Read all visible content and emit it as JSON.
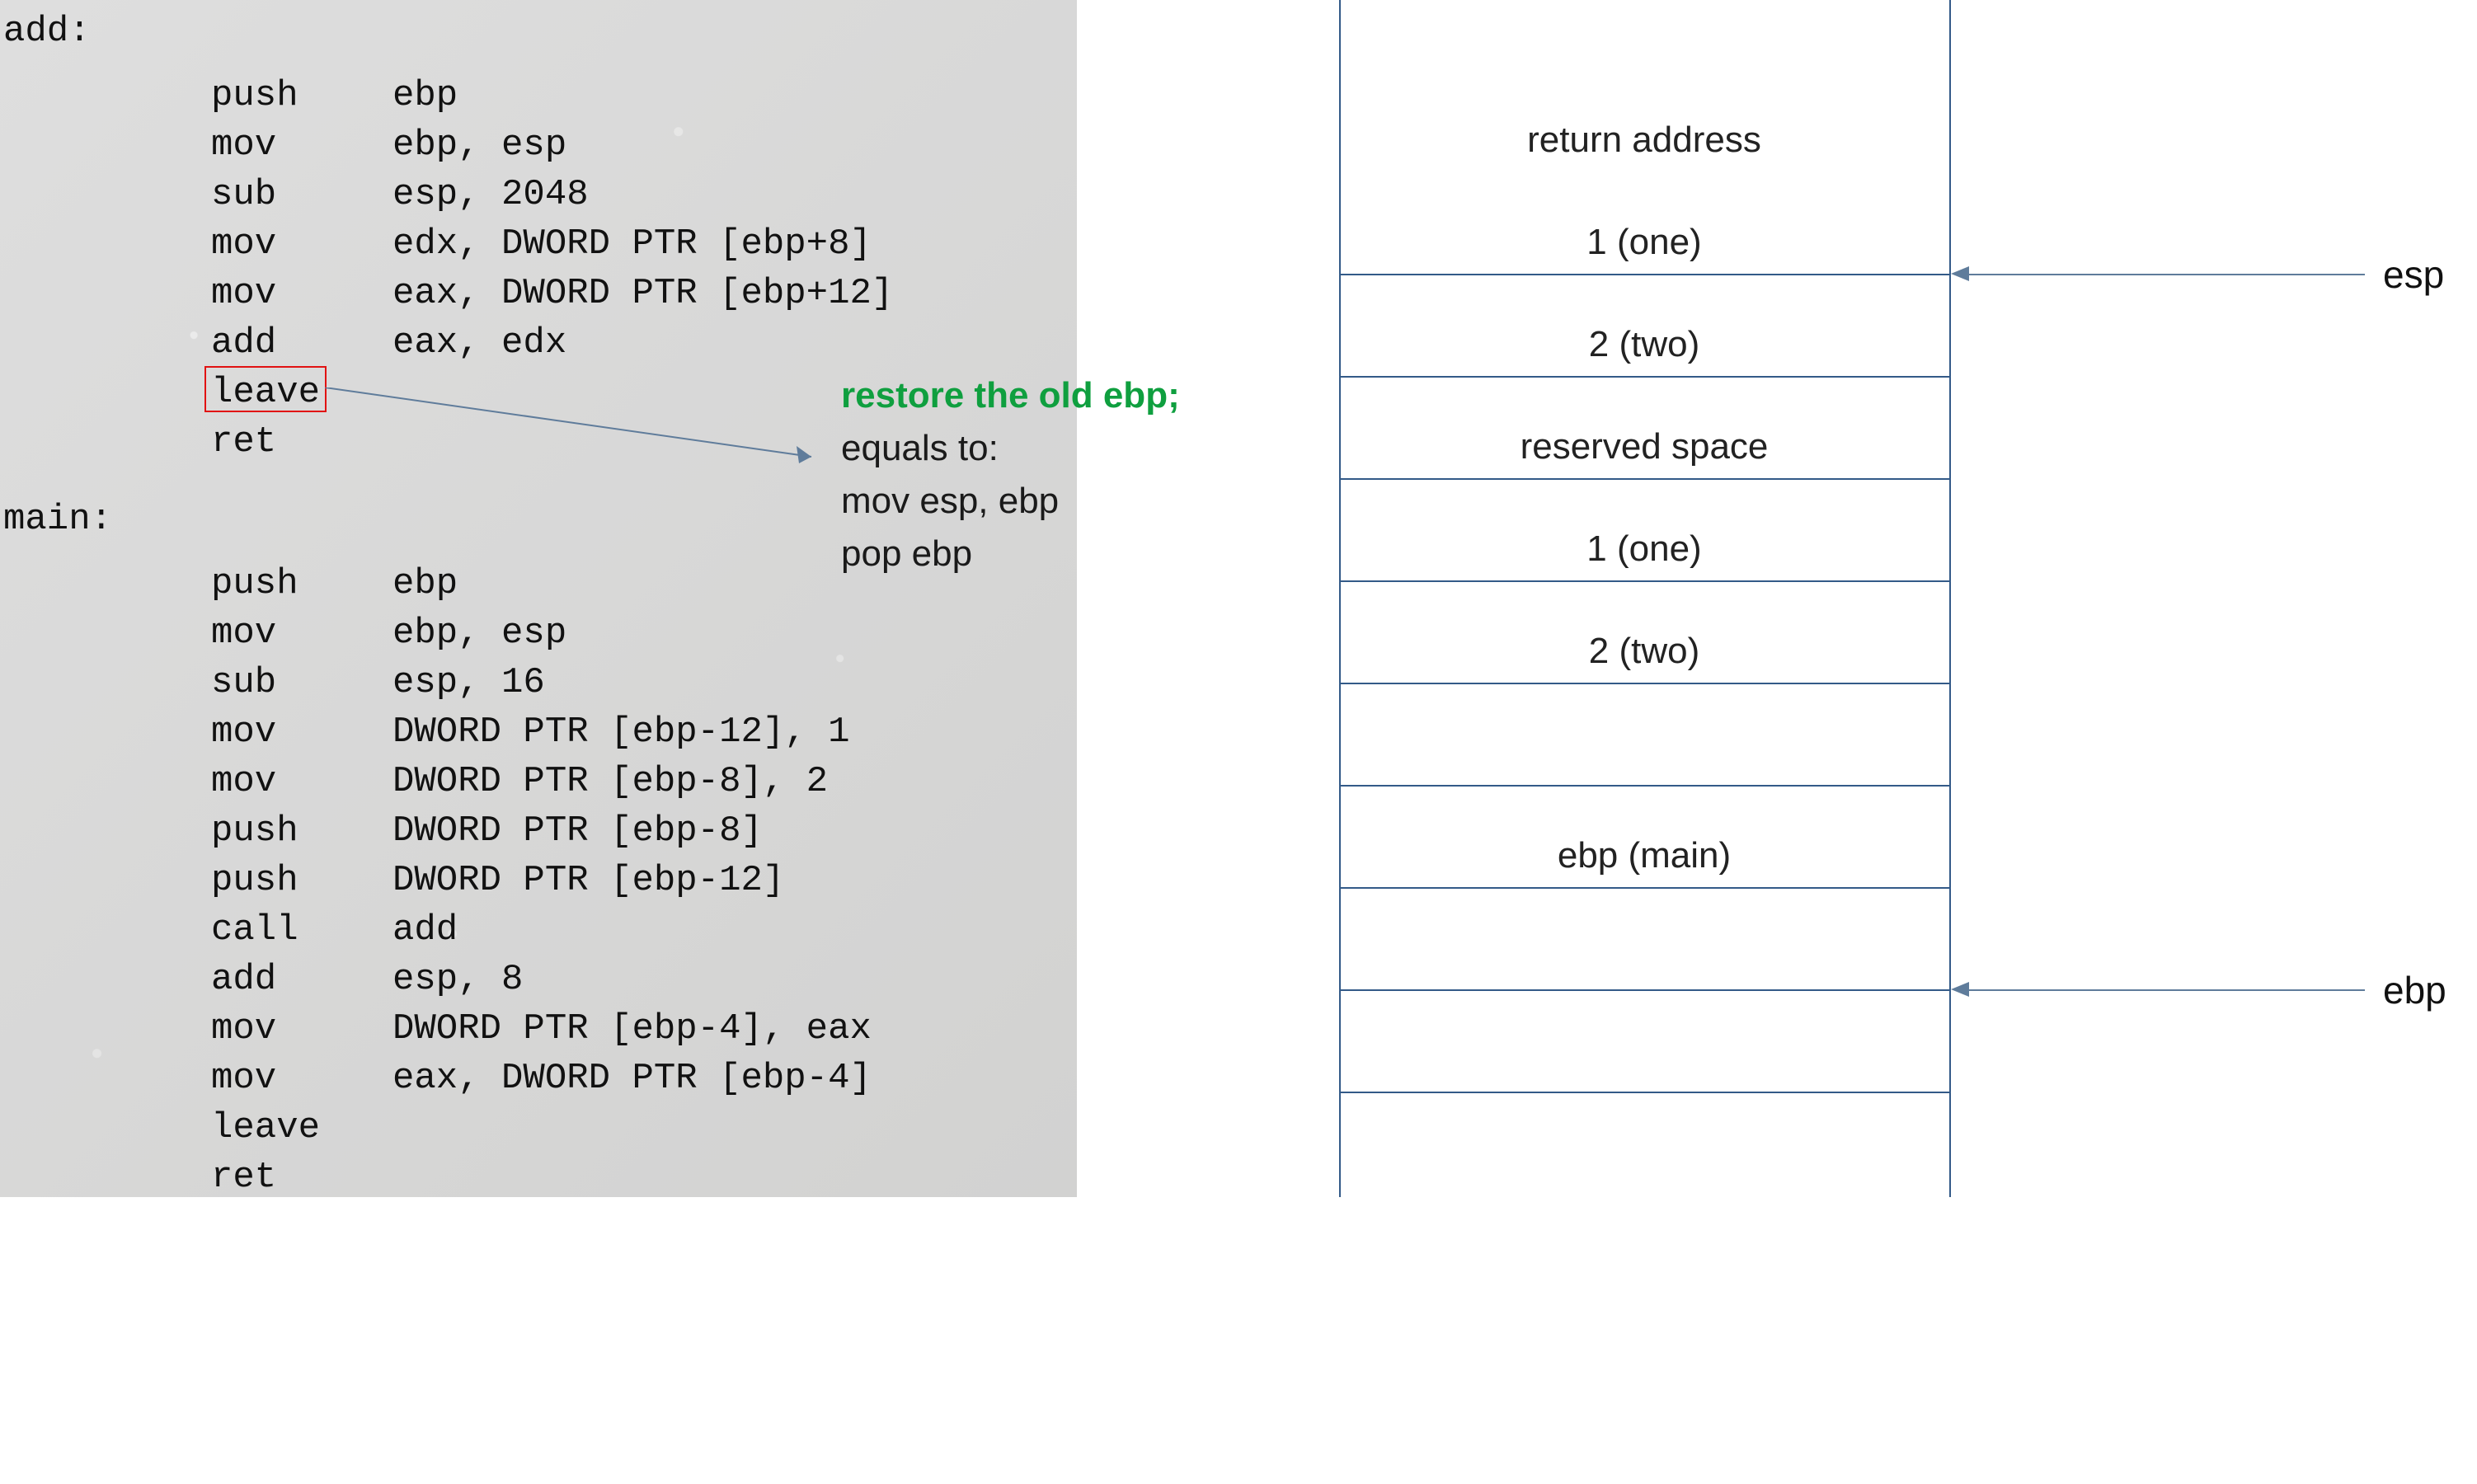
{
  "code": {
    "label_add": "add:",
    "label_main": "main:",
    "add": [
      {
        "ins": "push",
        "op": "ebp"
      },
      {
        "ins": "mov",
        "op": "ebp, esp"
      },
      {
        "ins": "sub",
        "op": "esp, 2048"
      },
      {
        "ins": "mov",
        "op": "edx, DWORD PTR [ebp+8]"
      },
      {
        "ins": "mov",
        "op": "eax, DWORD PTR [ebp+12]"
      },
      {
        "ins": "add",
        "op": "eax, edx"
      },
      {
        "ins": "leave",
        "op": ""
      },
      {
        "ins": "ret",
        "op": ""
      }
    ],
    "main": [
      {
        "ins": "push",
        "op": "ebp"
      },
      {
        "ins": "mov",
        "op": "ebp, esp"
      },
      {
        "ins": "sub",
        "op": "esp, 16"
      },
      {
        "ins": "mov",
        "op": "DWORD PTR [ebp-12], 1"
      },
      {
        "ins": "mov",
        "op": "DWORD PTR [ebp-8], 2"
      },
      {
        "ins": "push",
        "op": "DWORD PTR [ebp-8]"
      },
      {
        "ins": "push",
        "op": "DWORD PTR [ebp-12]"
      },
      {
        "ins": "call",
        "op": "add"
      },
      {
        "ins": "add",
        "op": "esp, 8"
      },
      {
        "ins": "mov",
        "op": "DWORD PTR [ebp-4], eax"
      },
      {
        "ins": "mov",
        "op": "eax, DWORD PTR [ebp-4]"
      },
      {
        "ins": "leave",
        "op": ""
      },
      {
        "ins": "ret",
        "op": ""
      }
    ]
  },
  "annotation": {
    "highlight": "restore the old ebp;",
    "line2": "equals to:",
    "line3": "mov esp, ebp",
    "line4": "pop ebp"
  },
  "stack": {
    "cells": [
      "",
      "",
      "return address",
      "1 (one)",
      "2 (two)",
      "reserved space",
      "1 (one)",
      "2 (two)",
      "",
      "ebp (main)",
      ""
    ],
    "pointers": {
      "esp": "esp",
      "ebp": "ebp"
    }
  }
}
